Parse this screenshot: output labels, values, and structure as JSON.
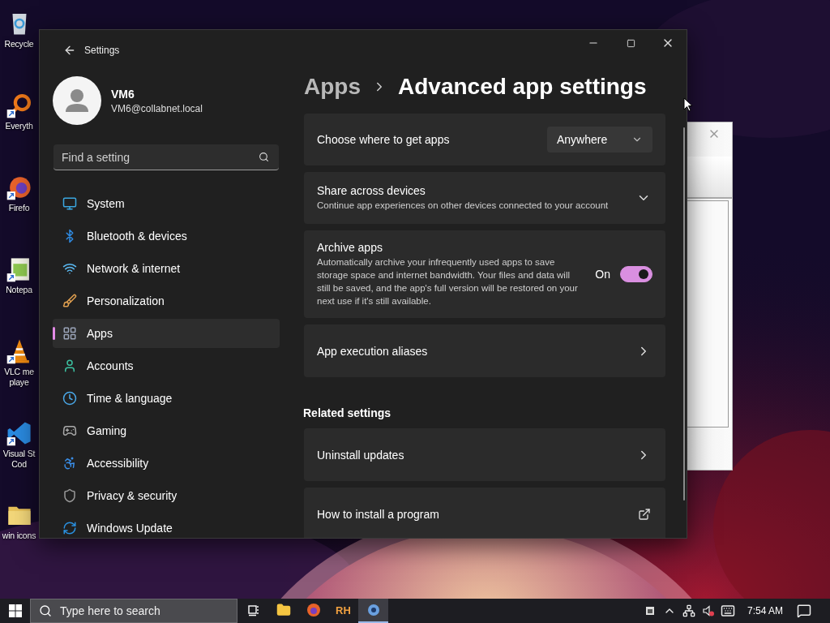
{
  "desktop_icons": [
    {
      "kind": "recycle",
      "lines": [
        "Recycle"
      ]
    },
    {
      "kind": "search",
      "lines": [
        "Everyth"
      ]
    },
    {
      "kind": "firefox",
      "lines": [
        "Firefo"
      ]
    },
    {
      "kind": "notepad",
      "lines": [
        "Notepa"
      ]
    },
    {
      "kind": "vlc",
      "lines": [
        "VLC me",
        "playe"
      ]
    },
    {
      "kind": "vscode",
      "lines": [
        "Visual St",
        "Cod"
      ]
    },
    {
      "kind": "folder",
      "lines": [
        "win icons"
      ]
    }
  ],
  "settings_window": {
    "title": "Settings",
    "user": {
      "name": "VM6",
      "email": "VM6@collabnet.local"
    },
    "search": {
      "placeholder": "Find a setting"
    },
    "nav": [
      {
        "label": "System",
        "selected": false
      },
      {
        "label": "Bluetooth & devices",
        "selected": false
      },
      {
        "label": "Network & internet",
        "selected": false
      },
      {
        "label": "Personalization",
        "selected": false
      },
      {
        "label": "Apps",
        "selected": true
      },
      {
        "label": "Accounts",
        "selected": false
      },
      {
        "label": "Time & language",
        "selected": false
      },
      {
        "label": "Gaming",
        "selected": false
      },
      {
        "label": "Accessibility",
        "selected": false
      },
      {
        "label": "Privacy & security",
        "selected": false
      },
      {
        "label": "Windows Update",
        "selected": false
      }
    ],
    "breadcrumb": {
      "parent": "Apps",
      "current": "Advanced app settings"
    },
    "cards": [
      {
        "kind": "dropdown",
        "title": "Choose where to get apps",
        "value": "Anywhere"
      },
      {
        "kind": "expander",
        "title": "Share across devices",
        "description": "Continue app experiences on other devices connected to your account",
        "expanded": false
      },
      {
        "kind": "toggle",
        "title": "Archive apps",
        "description": "Automatically archive your infrequently used apps to save storage space and internet bandwidth. Your files and data will still be saved, and the app's full version will be restored on your next use if it's still available.",
        "state_label": "On",
        "on": true
      },
      {
        "kind": "link",
        "title": "App execution aliases"
      }
    ],
    "related": {
      "heading": "Related settings",
      "cards": [
        {
          "kind": "link",
          "title": "Uninstall updates"
        },
        {
          "kind": "external",
          "title": "How to install a program"
        }
      ]
    }
  },
  "taskbar": {
    "search_placeholder": "Type here to search",
    "apps": [
      {
        "kind": "taskview",
        "selected": false
      },
      {
        "kind": "explorer",
        "selected": false
      },
      {
        "kind": "firefox",
        "selected": false
      },
      {
        "kind": "text",
        "label": "RH",
        "selected": false
      },
      {
        "kind": "settings",
        "selected": true
      }
    ],
    "volume_muted": true,
    "clock": "7:54 AM"
  }
}
